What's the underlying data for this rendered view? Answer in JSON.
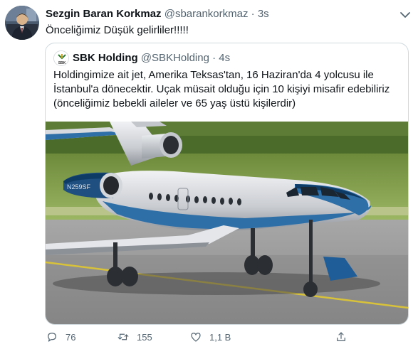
{
  "tweet": {
    "author_name": "Sezgin Baran Korkmaz",
    "author_handle": "@sbarankorkmaz",
    "separator": "·",
    "time": "3s",
    "text": "Önceliğimiz Düşük gelirliler!!!!!"
  },
  "quoted": {
    "author_name": "SBK Holding",
    "author_handle": "@SBKHolding",
    "separator": "·",
    "time": "4s",
    "text_lines": [
      "Holdingimize ait jet, Amerika Teksas'tan, 16 Haziran'da 4 yolcusu ile",
      "İstanbul'a dönecektir. Uçak müsait olduğu için 10 kişiyi misafir edebiliriz",
      "(önceliğimiz bebekli aileler ve 65 yaş üstü kişilerdir)"
    ],
    "logo_text": "SBK",
    "jet_registration": "N259SF"
  },
  "actions": {
    "reply_count": "76",
    "retweet_count": "155",
    "like_count": "1,1 B",
    "reply_icon": "reply-icon",
    "retweet_icon": "retweet-icon",
    "like_icon": "heart-icon",
    "share_icon": "share-icon"
  },
  "colors": {
    "text_primary": "#0f1419",
    "text_secondary": "#536471",
    "border": "#cfd9de",
    "jet_blue": "#2f6fa8"
  }
}
